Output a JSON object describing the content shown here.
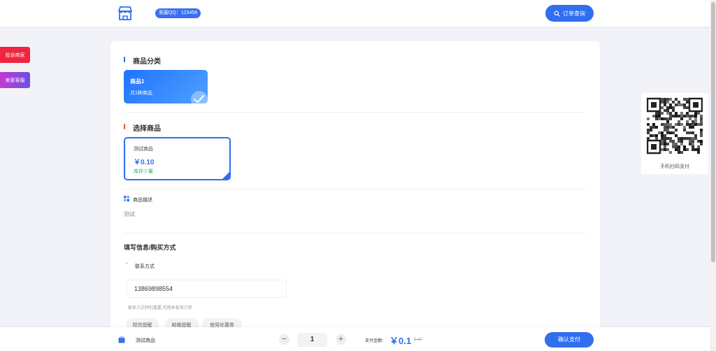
{
  "header": {
    "support_qq": "客服QQ：123456",
    "order_query_label": "订单查询"
  },
  "side": {
    "complaint_label": "投诉商家",
    "service_label": "卖家客服"
  },
  "category": {
    "title": "商品分类",
    "items": [
      {
        "name": "商品1",
        "count": "共1种商品"
      }
    ]
  },
  "goods": {
    "title": "选择商品",
    "items": [
      {
        "name": "测试商品",
        "price": "￥0.10",
        "stock": "库存少量"
      }
    ]
  },
  "description": {
    "title": "商品描述",
    "text": "测试"
  },
  "form": {
    "title": "填写信息/购买方式",
    "contact_label": "联系方式",
    "required_mark": "*",
    "contact_value": "13869898554",
    "contact_hint": "联系方式特别重要,可用来查询订单",
    "options": [
      "短信提醒",
      "邮箱提醒",
      "使用优惠券"
    ]
  },
  "qr": {
    "label": "手机扫码支付"
  },
  "bottom": {
    "product_name": "测试商品",
    "quantity": "1",
    "minus": "−",
    "plus": "+",
    "pay_label": "支付金额：",
    "pay_amount": "￥0.1",
    "original_price": "0.10",
    "confirm_label": "确认支付"
  },
  "colors": {
    "primary": "#2f6ff0",
    "danger": "#f0253f",
    "stock_green": "#1eb86a"
  }
}
